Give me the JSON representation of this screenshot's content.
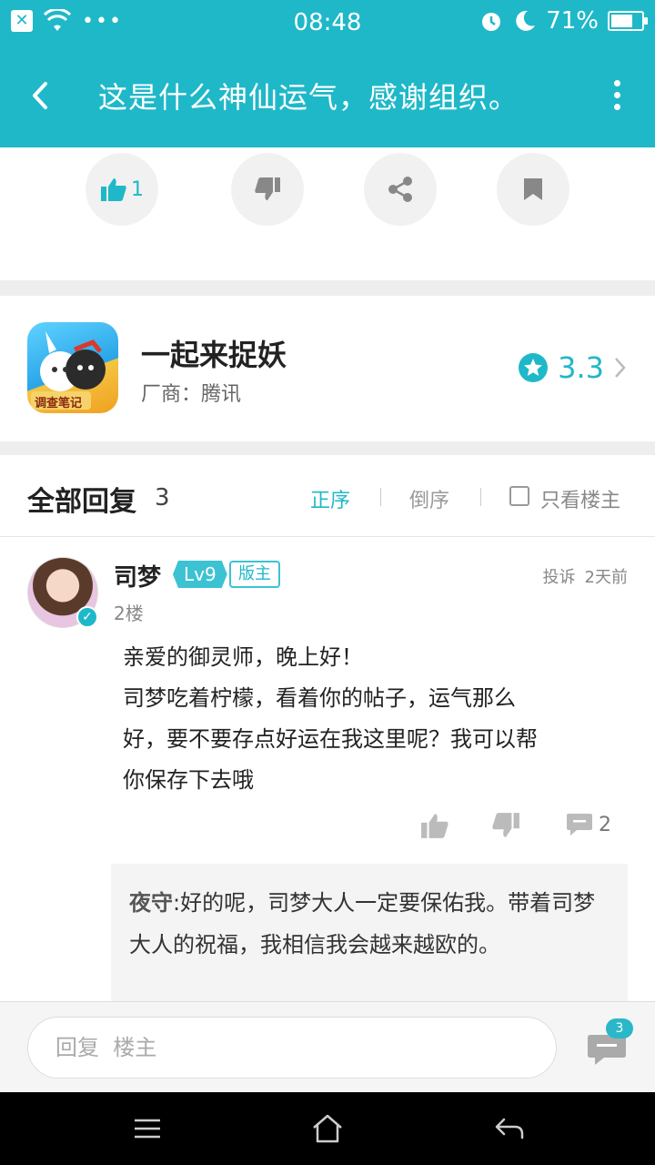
{
  "status_bar": {
    "time": "08:48",
    "battery": "71%",
    "battery_level": 0.71
  },
  "header": {
    "title": "这是什么神仙运气，感谢组织。"
  },
  "actions": {
    "like_count": "1"
  },
  "game": {
    "name": "一起来捉妖",
    "vendor_label": "厂商：",
    "vendor": "腾讯",
    "rating": "3.3",
    "icon_caption": "调查笔记"
  },
  "replies": {
    "title": "全部回复",
    "count": "3",
    "sort_asc": "正序",
    "sort_desc": "倒序",
    "only_op": "只看楼主",
    "post": {
      "username": "司梦",
      "level": "Lv9",
      "role": "版主",
      "floor": "2楼",
      "report": "投诉",
      "time": "2天前",
      "lines": [
        "亲爱的御灵师，晚上好！",
        "司梦吃着柠檬，看着你的帖子，运气那么",
        "好，要不要存点好运在我这里呢？我可以帮",
        "你保存下去哦"
      ],
      "comment_count": "2",
      "sub_reply": {
        "author": "夜守",
        "text": ":好的呢，司梦大人一定要保佑我。带着司梦大人的祝福，我相信我会越来越欧的。"
      }
    }
  },
  "input": {
    "placeholder": "回复  楼主",
    "badge": "3"
  },
  "colors": {
    "accent": "#1fb8c8",
    "background": "#eeeeee"
  }
}
